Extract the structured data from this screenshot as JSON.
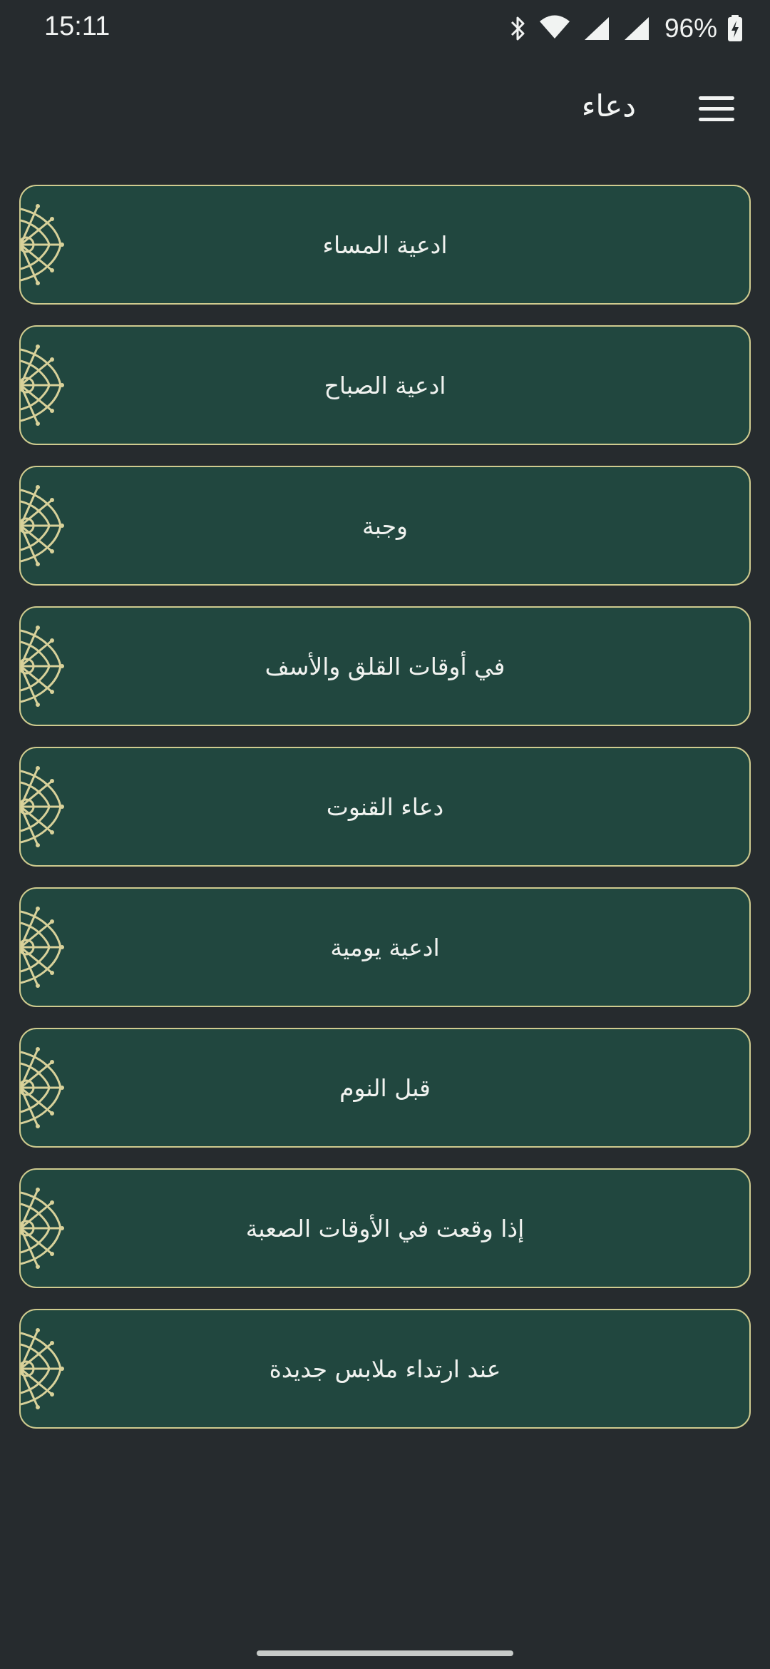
{
  "status_bar": {
    "time": "15:11",
    "battery_text": "96%",
    "icons": [
      "bluetooth-icon",
      "wifi-icon",
      "signal-icon",
      "signal-icon",
      "battery-charging-icon"
    ]
  },
  "app_bar": {
    "title": "دعاء",
    "menu_icon": "hamburger-menu-icon"
  },
  "items": [
    {
      "label": "ادعية المساء"
    },
    {
      "label": "ادعية الصباح"
    },
    {
      "label": "وجبة"
    },
    {
      "label": "في أوقات القلق والأسف"
    },
    {
      "label": "دعاء القنوت"
    },
    {
      "label": "ادعية يومية"
    },
    {
      "label": "قبل النوم"
    },
    {
      "label": "إذا وقعت في الأوقات الصعبة"
    },
    {
      "label": "عند ارتداء ملابس جديدة"
    }
  ],
  "colors": {
    "background": "#262B2E",
    "card_fill": "#21473F",
    "card_border": "#CFCB8F",
    "ornament": "#D8D19A"
  }
}
